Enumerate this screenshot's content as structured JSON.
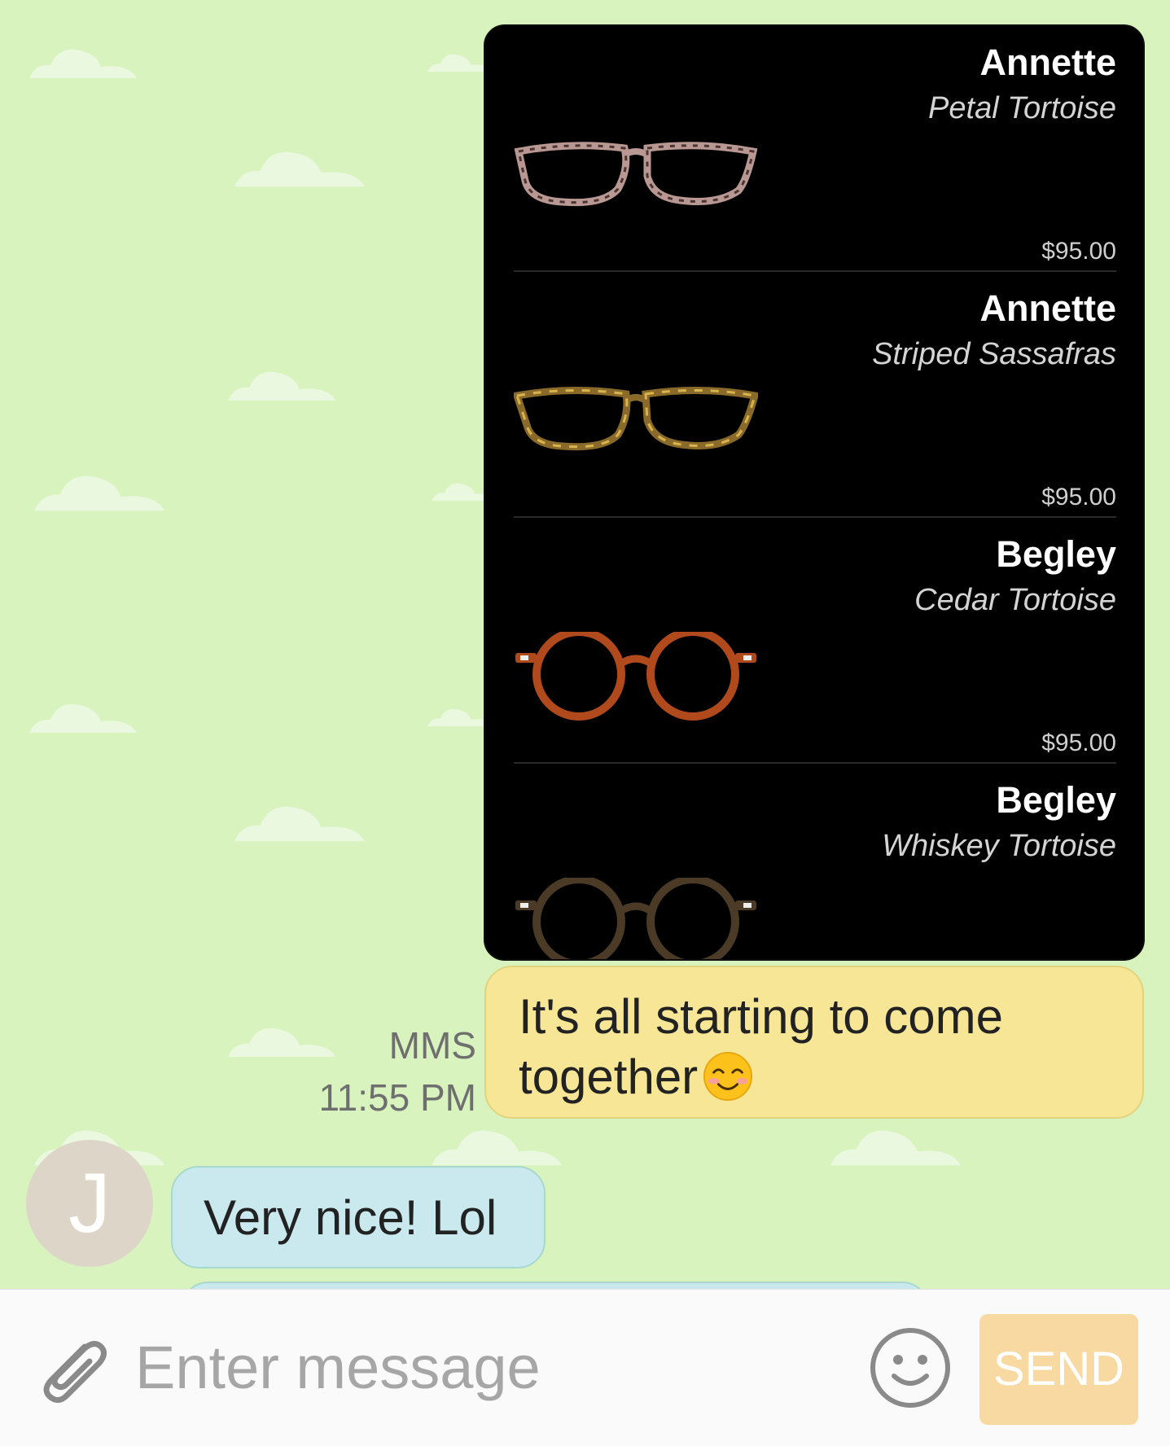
{
  "products": [
    {
      "name": "Annette",
      "color": "Petal Tortoise",
      "price": "$95.00"
    },
    {
      "name": "Annette",
      "color": "Striped Sassafras",
      "price": "$95.00"
    },
    {
      "name": "Begley",
      "color": "Cedar Tortoise",
      "price": "$95.00"
    },
    {
      "name": "Begley",
      "color": "Whiskey Tortoise",
      "price": ""
    }
  ],
  "sent_message": {
    "text": "It's all starting to come together",
    "type": "MMS",
    "time": "11:55 PM"
  },
  "received_message": {
    "avatar_initial": "J",
    "text": "Very nice! Lol"
  },
  "input_bar": {
    "placeholder": "Enter message",
    "send_label": "SEND",
    "attach_icon": "paperclip-icon",
    "emoji_icon": "smiley-icon"
  },
  "colors": {
    "background": "#d8f3bd",
    "sent_bubble": "#f6e696",
    "received_bubble": "#c9e9ee",
    "send_button": "#f8d9a2"
  }
}
